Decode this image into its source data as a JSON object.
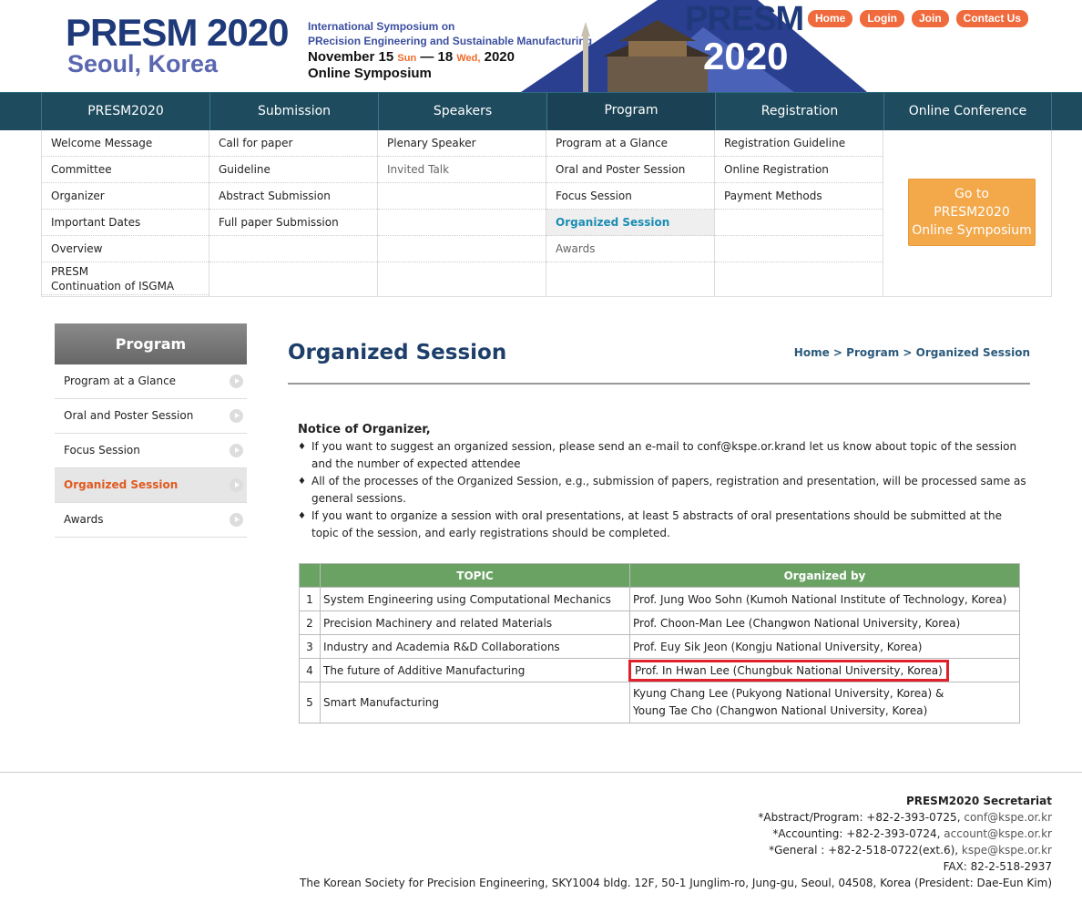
{
  "header": {
    "logo_title": "PRESM 2020",
    "logo_sub": "Seoul, Korea",
    "symp_line1": "International Symposium on",
    "symp_line2": "PRecision Engineering and Sustainable Manufacturing",
    "date_a": "November 15",
    "dow_a": "Sun",
    "date_sep": "— 18",
    "dow_b": "Wed,",
    "date_year": "2020",
    "online": "Online Symposium",
    "banner_line1": "PRESM",
    "banner_line2": "2020",
    "links": [
      "Home",
      "Login",
      "Join",
      "Contact Us"
    ]
  },
  "nav": [
    "PRESM2020",
    "Submission",
    "Speakers",
    "Program",
    "Registration",
    "Online Conference"
  ],
  "mega": {
    "col1": [
      "Welcome Message",
      "Committee",
      "Organizer",
      "Important Dates",
      "Overview",
      "PRESM",
      "Continuation of ISGMA"
    ],
    "col2": [
      "Call for paper",
      "Guideline",
      "Abstract Submission",
      "Full paper Submission"
    ],
    "col3": [
      "Plenary Speaker",
      "Invited Talk"
    ],
    "col4": [
      "Program at a Glance",
      "Oral and Poster Session",
      "Focus Session",
      "Organized Session",
      "Awards"
    ],
    "col5": [
      "Registration Guideline",
      "Online Registration",
      "Payment Methods"
    ],
    "goto": [
      "Go to",
      "PRESM2020",
      "Online Symposium"
    ]
  },
  "sidebar": {
    "title": "Program",
    "items": [
      "Program at a Glance",
      "Oral and Poster Session",
      "Focus Session",
      "Organized Session",
      "Awards"
    ]
  },
  "content": {
    "title": "Organized Session",
    "crumb": [
      "Home",
      ">",
      "Program",
      ">",
      "Organized Session"
    ],
    "notice_head": "Notice of Organizer,",
    "notice_items": [
      "If you want to suggest an organized session, please send an e-mail to conf@kspe.or.krand let us know about topic of the session and the number of expected attendee",
      "All of the processes of the Organized Session, e.g., submission of papers, registration and presentation, will be processed same as general sessions.",
      "If you want to organize a session with oral presentations, at least 5 abstracts of oral presentations should be submitted at the topic of the session, and early registrations should be completed."
    ],
    "table": {
      "headers": [
        "",
        "TOPIC",
        "Organized by"
      ],
      "rows": [
        {
          "num": "1",
          "topic": "System Engineering using Computational Mechanics",
          "org": "Prof. Jung Woo Sohn (Kumoh National Institute of Technology, Korea)"
        },
        {
          "num": "2",
          "topic": "Precision Machinery and related Materials",
          "org": "Prof. Choon-Man Lee (Changwon National University, Korea)"
        },
        {
          "num": "3",
          "topic": "Industry and Academia R&D Collaborations",
          "org": "Prof. Euy Sik Jeon (Kongju National University, Korea)"
        },
        {
          "num": "4",
          "topic": "The future of Additive Manufacturing",
          "org": "Prof. In Hwan Lee (Chungbuk National University, Korea)"
        },
        {
          "num": "5",
          "topic": "Smart Manufacturing",
          "org": "Kyung Chang Lee (Pukyong National University, Korea) &",
          "org2": "Young Tae Cho (Changwon National University, Korea)"
        }
      ]
    }
  },
  "footer": {
    "title": "PRESM2020 Secretariat",
    "l1": "*Abstract/Program: +82-2-393-0725,",
    "l1m": "conf@kspe.or.kr",
    "l2": "*Accounting: +82-2-393-0724,",
    "l2m": "account@kspe.or.kr",
    "l3": "*General : +82-2-518-0722(ext.6),",
    "l3m": "kspe@kspe.or.kr",
    "fax": "FAX: 82-2-518-2937",
    "address": "The Korean Society for Precision Engineering, SKY1004 bldg. 12F, 50-1 Junglim-ro, Jung-gu, Seoul, 04508, Korea (President: Dae-Eun Kim)"
  },
  "colors": {
    "nav_bg": "#1e4b5e",
    "accent_orange": "#ef6a3c",
    "table_header": "#6aa264",
    "highlight": "#e0202a"
  }
}
